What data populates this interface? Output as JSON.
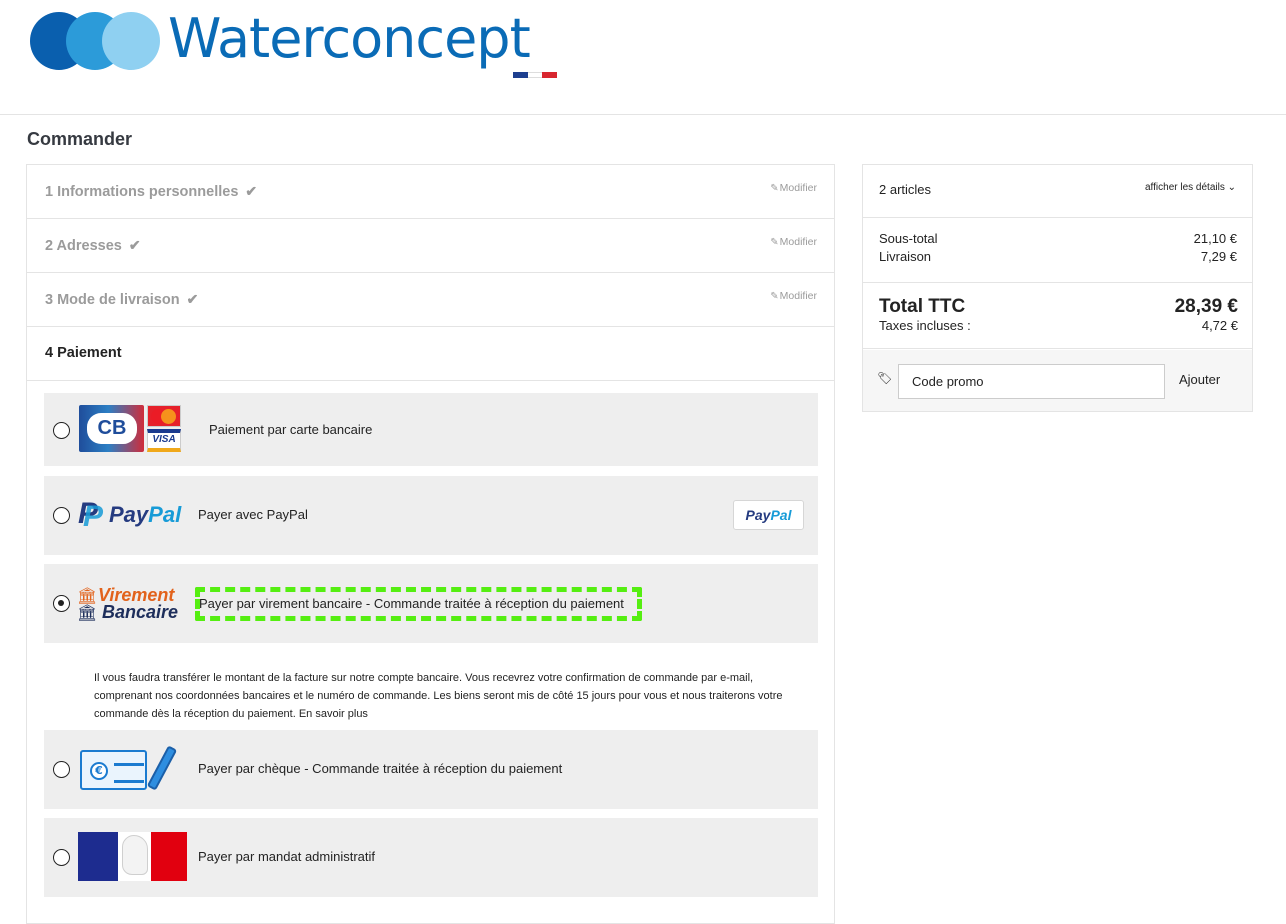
{
  "brand": {
    "name": "Waterconcept"
  },
  "page": {
    "title": "Commander"
  },
  "steps": [
    {
      "title": "1 Informations personnelles",
      "edit": "Modifier"
    },
    {
      "title": "2 Adresses",
      "edit": "Modifier"
    },
    {
      "title": "3 Mode de livraison",
      "edit": "Modifier"
    },
    {
      "title": "4 Paiement"
    }
  ],
  "payment": {
    "options": [
      {
        "label": "Paiement par carte bancaire",
        "logo_text": "CB",
        "badges": [
          "MasterCard",
          "VISA"
        ],
        "selected": false
      },
      {
        "label": "Payer avec PayPal",
        "logo_text": "PayPal",
        "button_text": "PayPal",
        "selected": false
      },
      {
        "label": "Payer par virement bancaire - Commande traitée à réception du paiement",
        "logo_line1": "Virement",
        "logo_line2": "Bancaire",
        "selected": true
      },
      {
        "label": "Payer par chèque - Commande traitée à réception du paiement",
        "logo_icon": "cheque-icon",
        "selected": false
      },
      {
        "label": "Payer par mandat administratif",
        "logo_icon": "marianne-icon",
        "selected": false
      }
    ],
    "transfer_description": "Il vous faudra transférer le montant de la facture sur notre compte bancaire. Vous recevrez votre confirmation de commande par e-mail, comprenant nos coordonnées bancaires et le numéro de commande. Les biens seront mis de côté 15 jours pour vous et nous traiterons votre commande dès la réception du paiement. En savoir plus"
  },
  "summary": {
    "articles": "2 articles",
    "details_link": "afficher les détails",
    "subtotal_label": "Sous-total",
    "subtotal_value": "21,10 €",
    "shipping_label": "Livraison",
    "shipping_value": "7,29 €",
    "total_label": "Total TTC",
    "total_value": "28,39 €",
    "tax_label": "Taxes incluses :",
    "tax_value": "4,72 €",
    "promo_placeholder": "Code promo",
    "promo_button": "Ajouter"
  },
  "colors": {
    "brand_blue": "#0a6bb6",
    "option_bg": "#eeeeee",
    "highlight": "#55ee11",
    "paypal_dark": "#253b80",
    "paypal_light": "#179bd7"
  }
}
